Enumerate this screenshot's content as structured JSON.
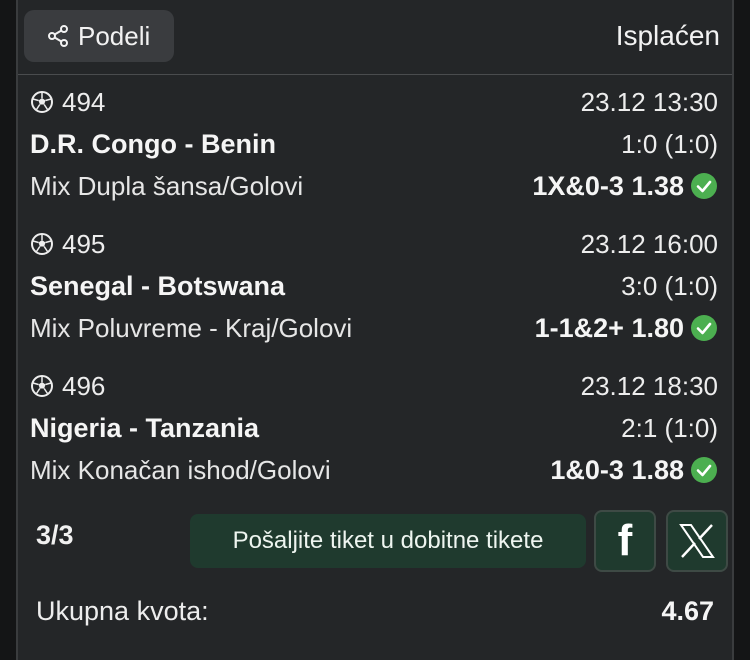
{
  "header": {
    "share_label": "Podeli",
    "status": "Isplaćen"
  },
  "matches": [
    {
      "id": "494",
      "datetime": "23.12 13:30",
      "teams": "D.R. Congo - Benin",
      "score": "1:0 (1:0)",
      "market": "Mix Dupla šansa/Golovi",
      "pick": "1X&0-3 1.38",
      "won": true
    },
    {
      "id": "495",
      "datetime": "23.12 16:00",
      "teams": "Senegal - Botswana",
      "score": "3:0 (1:0)",
      "market": "Mix Poluvreme - Kraj/Golovi",
      "pick": "1-1&2+ 1.80",
      "won": true
    },
    {
      "id": "496",
      "datetime": "23.12 18:30",
      "teams": "Nigeria - Tanzania",
      "score": "2:1 (1:0)",
      "market": "Mix Konačan ishod/Golovi",
      "pick": "1&0-3 1.88",
      "won": true
    }
  ],
  "footer": {
    "count": "3/3",
    "send_label": "Pošaljite tiket u dobitne tikete",
    "facebook_label": "f",
    "total_label": "Ukupna kvota:",
    "total_value": "4.67"
  },
  "colors": {
    "background": "#242628",
    "success_green": "#4caf50",
    "button_green": "#1f3a2e"
  }
}
